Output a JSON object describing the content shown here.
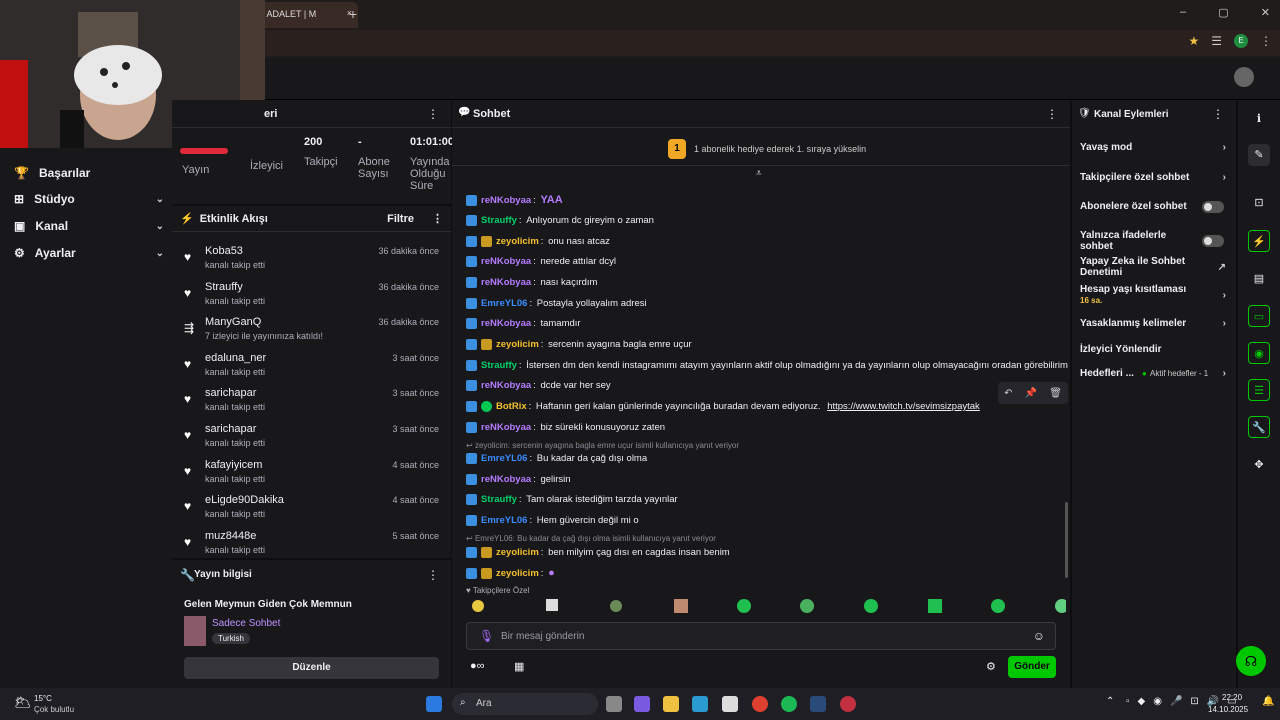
{
  "browser": {
    "tab_title": "K, ADALET | M",
    "new_tab": "+",
    "close_tab": "×",
    "window": {
      "minimize": "–",
      "maximize": "▢",
      "close": "✕"
    },
    "profile_letter": "E"
  },
  "left_nav": {
    "items": [
      {
        "label": "Başarılar",
        "icon": "trophy-icon"
      },
      {
        "label": "Stüdyo",
        "icon": "studio-icon"
      },
      {
        "label": "Kanal",
        "icon": "channel-icon"
      },
      {
        "label": "Ayarlar",
        "icon": "gear-icon"
      }
    ]
  },
  "stats": {
    "header_suffix": "eri",
    "items": [
      {
        "value": "",
        "label": "Yayın"
      },
      {
        "value": "",
        "label": "İzleyici"
      },
      {
        "value": "200",
        "label": "Takipçi"
      },
      {
        "value": "-",
        "label": "Abone Sayısı"
      },
      {
        "value": "01:01:00",
        "label": "Yayında Olduğu Süre"
      }
    ]
  },
  "activity": {
    "title": "Etkinlik Akışı",
    "filter": "Filtre",
    "items": [
      {
        "name": "Koba53",
        "sub": "kanalı takip etti",
        "time": "36 dakika önce",
        "icon": "heart-icon"
      },
      {
        "name": "Strauffy",
        "sub": "kanalı takip etti",
        "time": "36 dakika önce",
        "icon": "heart-icon"
      },
      {
        "name": "ManyGanQ",
        "sub": "7 izleyici ile yayınınıza katıldı!",
        "time": "36 dakika önce",
        "icon": "raid-icon"
      },
      {
        "name": "edaluna_ner",
        "sub": "kanalı takip etti",
        "time": "3 saat önce",
        "icon": "heart-icon"
      },
      {
        "name": "sarichapar",
        "sub": "kanalı takip etti",
        "time": "3 saat önce",
        "icon": "heart-icon"
      },
      {
        "name": "sarichapar",
        "sub": "kanalı takip etti",
        "time": "3 saat önce",
        "icon": "heart-icon"
      },
      {
        "name": "kafayiyicem",
        "sub": "kanalı takip etti",
        "time": "4 saat önce",
        "icon": "heart-icon"
      },
      {
        "name": "eLigde90Dakika",
        "sub": "kanalı takip etti",
        "time": "4 saat önce",
        "icon": "heart-icon"
      },
      {
        "name": "muz8448e",
        "sub": "kanalı takip etti",
        "time": "5 saat önce",
        "icon": "heart-icon"
      }
    ]
  },
  "stream_info": {
    "title": "Yayın bilgisi",
    "stream_title": "Gelen Meymun Giden Çok Memnun",
    "category": "Sadece Sohbet",
    "tag": "Turkish",
    "edit_button": "Düzenle"
  },
  "chat": {
    "title": "Sohbet",
    "goal_number": "1",
    "goal_text": "1 abonelik hediye ederek 1. sıraya yükselin",
    "messages": [
      {
        "user": "reNKobyaa",
        "color": "#b57bff",
        "text": "",
        "badge": "blue",
        "emote": "YAA"
      },
      {
        "user": "Strauffy",
        "color": "#00d26a",
        "text": "Anlıyorum dc gireyim o zaman",
        "badge": "blue"
      },
      {
        "user": "zeyolicim",
        "color": "#f5c12e",
        "text": "onu nası atcaz",
        "badge": "crown"
      },
      {
        "user": "reNKobyaa",
        "color": "#b57bff",
        "text": "nerede attılar dcyl",
        "badge": "blue"
      },
      {
        "user": "reNKobyaa",
        "color": "#b57bff",
        "text": "nası kaçırdım",
        "badge": "blue"
      },
      {
        "user": "EmreYL06",
        "color": "#3b8cff",
        "text": "Postayla yollayalım adresi",
        "badge": "blue"
      },
      {
        "user": "reNKobyaa",
        "color": "#b57bff",
        "text": "tamamdır",
        "badge": "blue"
      },
      {
        "user": "zeyolicim",
        "color": "#f5c12e",
        "text": "sercenin ayagına bagla emre uçur",
        "badge": "crown"
      },
      {
        "user": "Strauffy",
        "color": "#00d26a",
        "text": "İstersen dm den kendi instagramımı atayım yayınların aktif olup olmadığını ya da yayınların olup olmayacağını oradan görebilirim",
        "badge": "blue"
      },
      {
        "user": "reNKobyaa",
        "color": "#b57bff",
        "text": "dcde var her sey",
        "badge": "blue"
      },
      {
        "user": "BotRix",
        "color": "#f5c12e",
        "text": "Haftanın geri kalan günlerinde yayıncılığa buradan devam ediyoruz.",
        "link": "https://www.twitch.tv/sevimsizpaytak",
        "badge": "bot"
      },
      {
        "user": "reNKobyaa",
        "color": "#b57bff",
        "text": "biz sürekli konusuyoruz zaten",
        "badge": "blue"
      },
      {
        "reply": "zeyolicim: sercenin ayagına bagla emre uçur isimli kullanıcıya yanıt veriyor"
      },
      {
        "user": "EmreYL06",
        "color": "#3b8cff",
        "text": "Bu kadar da çağ dışı olma",
        "badge": "blue"
      },
      {
        "user": "reNKobyaa",
        "color": "#b57bff",
        "text": "gelirsin",
        "badge": "blue"
      },
      {
        "user": "Strauffy",
        "color": "#00d26a",
        "text": "Tam olarak istediğim tarzda yayınlar",
        "badge": "blue"
      },
      {
        "user": "EmreYL06",
        "color": "#3b8cff",
        "text": "Hem güvercin değil mi o",
        "badge": "blue"
      },
      {
        "reply": "EmreYL06: Bu kadar da çağ dışı olma isimli kullanıcıya yanıt veriyor"
      },
      {
        "user": "zeyolicim",
        "color": "#f5c12e",
        "text": "ben milyim çag dısı en cagdas insan benim",
        "badge": "crown"
      },
      {
        "user": "zeyolicim",
        "color": "#f5c12e",
        "text": "",
        "badge": "crown",
        "emote": "●"
      }
    ],
    "followers_only": "Takipçilere Özel",
    "input_placeholder": "Bir mesaj gönderin",
    "send_label": "Gönder"
  },
  "channel_actions": {
    "title": "Kanal Eylemleri",
    "items": [
      {
        "label": "Yavaş mod",
        "type": "arrow"
      },
      {
        "label": "Takipçilere özel sohbet",
        "type": "arrow"
      },
      {
        "label": "Abonelere özel sohbet",
        "type": "toggle"
      },
      {
        "label": "Yalnızca ifadelerle sohbet",
        "type": "toggle"
      },
      {
        "label": "Yapay Zeka ile Sohbet Denetimi",
        "type": "external"
      },
      {
        "label": "Hesap yaşı kısıtlaması",
        "sub": "16 sa.",
        "type": "arrow"
      },
      {
        "label": "Yasaklanmış kelimeler",
        "type": "arrow"
      },
      {
        "label": "İzleyici Yönlendir",
        "type": "none"
      },
      {
        "label": "Hedefleri ...",
        "status": "Aktif hedefler - 1",
        "type": "arrow"
      }
    ]
  },
  "taskbar": {
    "weather_temp": "15°C",
    "weather_desc": "Çok bulutlu",
    "search": "Ara",
    "time": "22:20",
    "date": "14.10.2025"
  }
}
